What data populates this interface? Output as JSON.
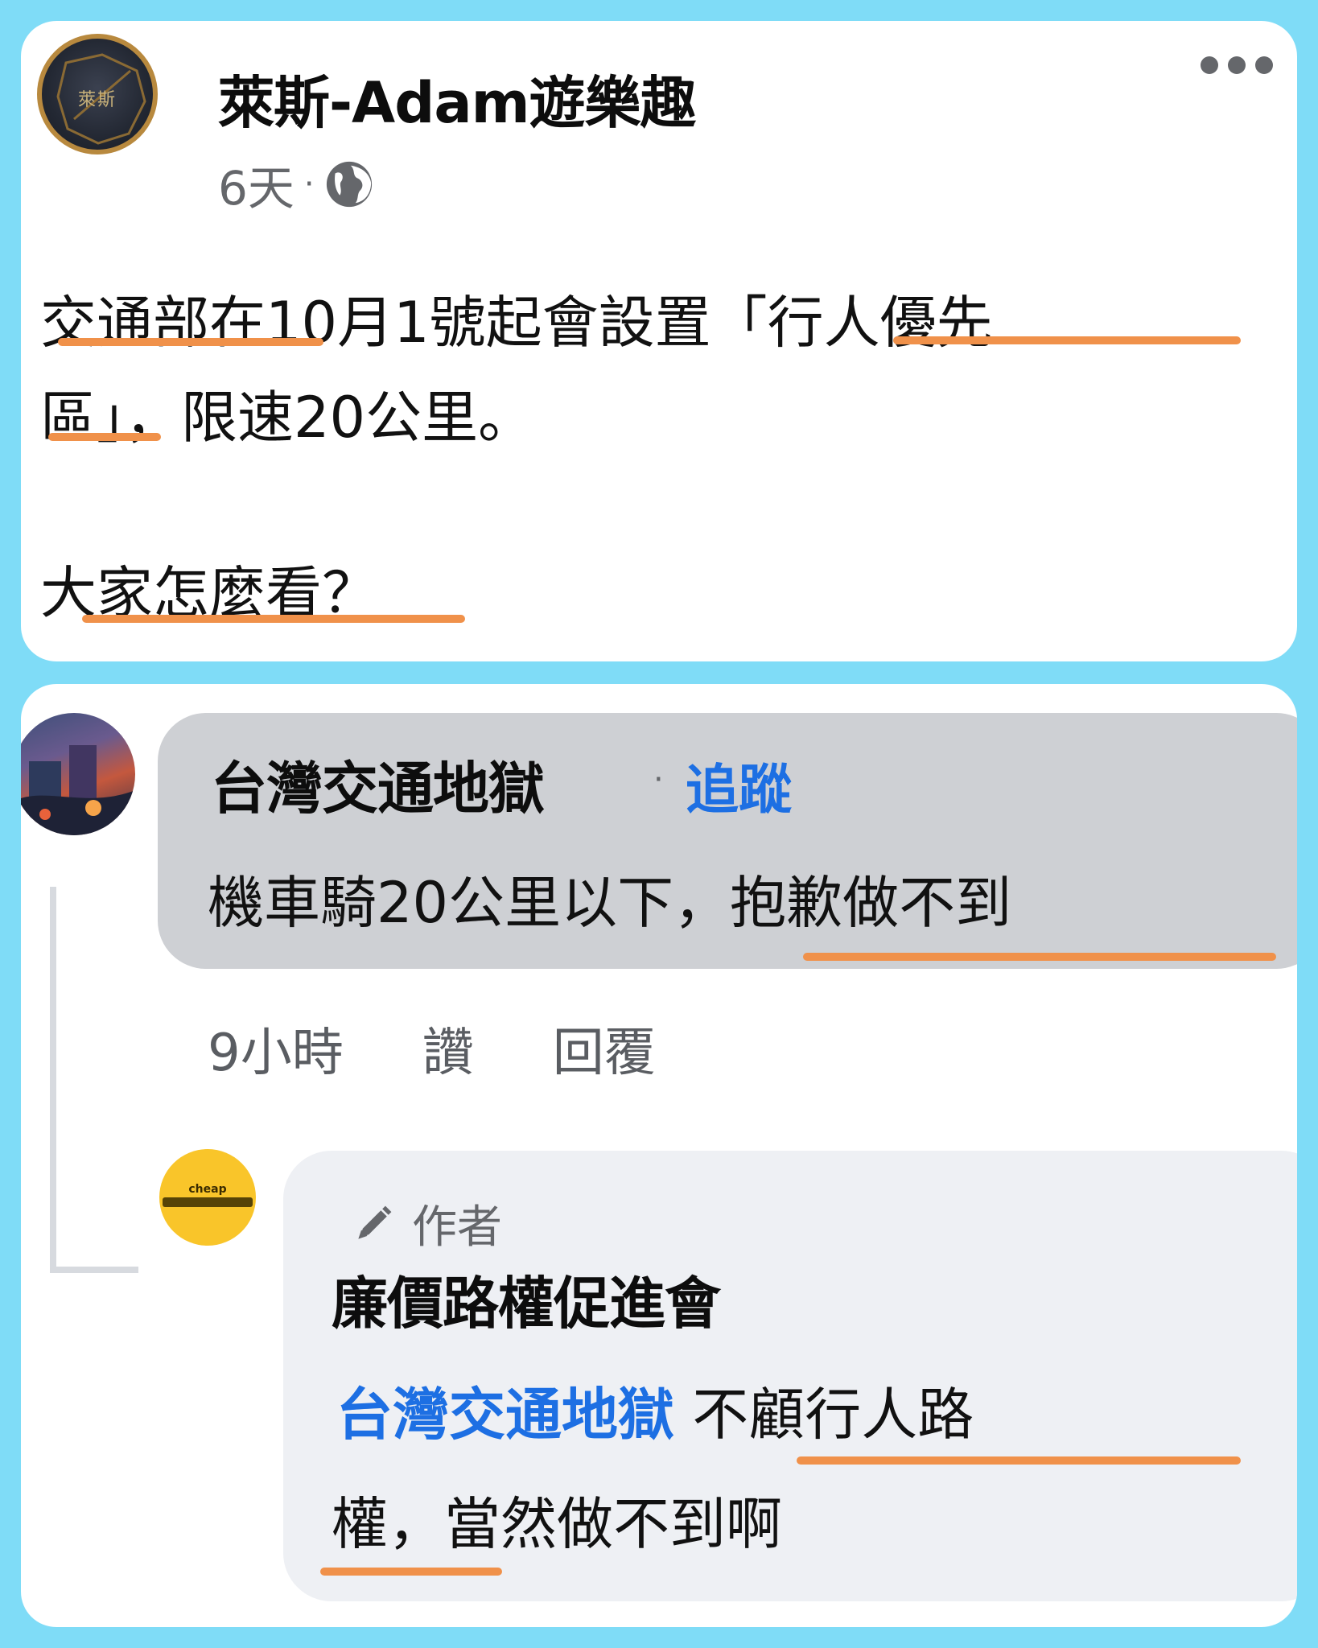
{
  "post": {
    "page_name": "萊斯-Adam遊樂趣",
    "avatar_text": "萊斯",
    "time": "6天",
    "separator": "·",
    "privacy_icon": "globe-icon",
    "more_icon": "more-icon",
    "line1": "交通部在10月1號起會設置「行人優先",
    "line2": "區」，限速20公里。",
    "line3": "大家怎麼看？"
  },
  "comment1": {
    "author": "台灣交通地獄",
    "separator": "·",
    "follow_label": "追蹤",
    "text": "機車騎20公里以下，抱歉做不到",
    "time": "9小時",
    "like_label": "讚",
    "reply_label": "回覆"
  },
  "comment2": {
    "avatar_text": "cheap",
    "badge_icon": "pencil-icon",
    "badge_label": "作者",
    "author": "廉價路權促進會",
    "mention": "台灣交通地獄",
    "text_rest": "不顧行人路",
    "text_line2": "權，當然做不到啊"
  },
  "colors": {
    "page_background": "#7fdcf7",
    "underline": "#f0914a",
    "link": "#1d6fe3",
    "bubble_primary": "#ced0d4",
    "bubble_secondary": "#eef0f4"
  }
}
